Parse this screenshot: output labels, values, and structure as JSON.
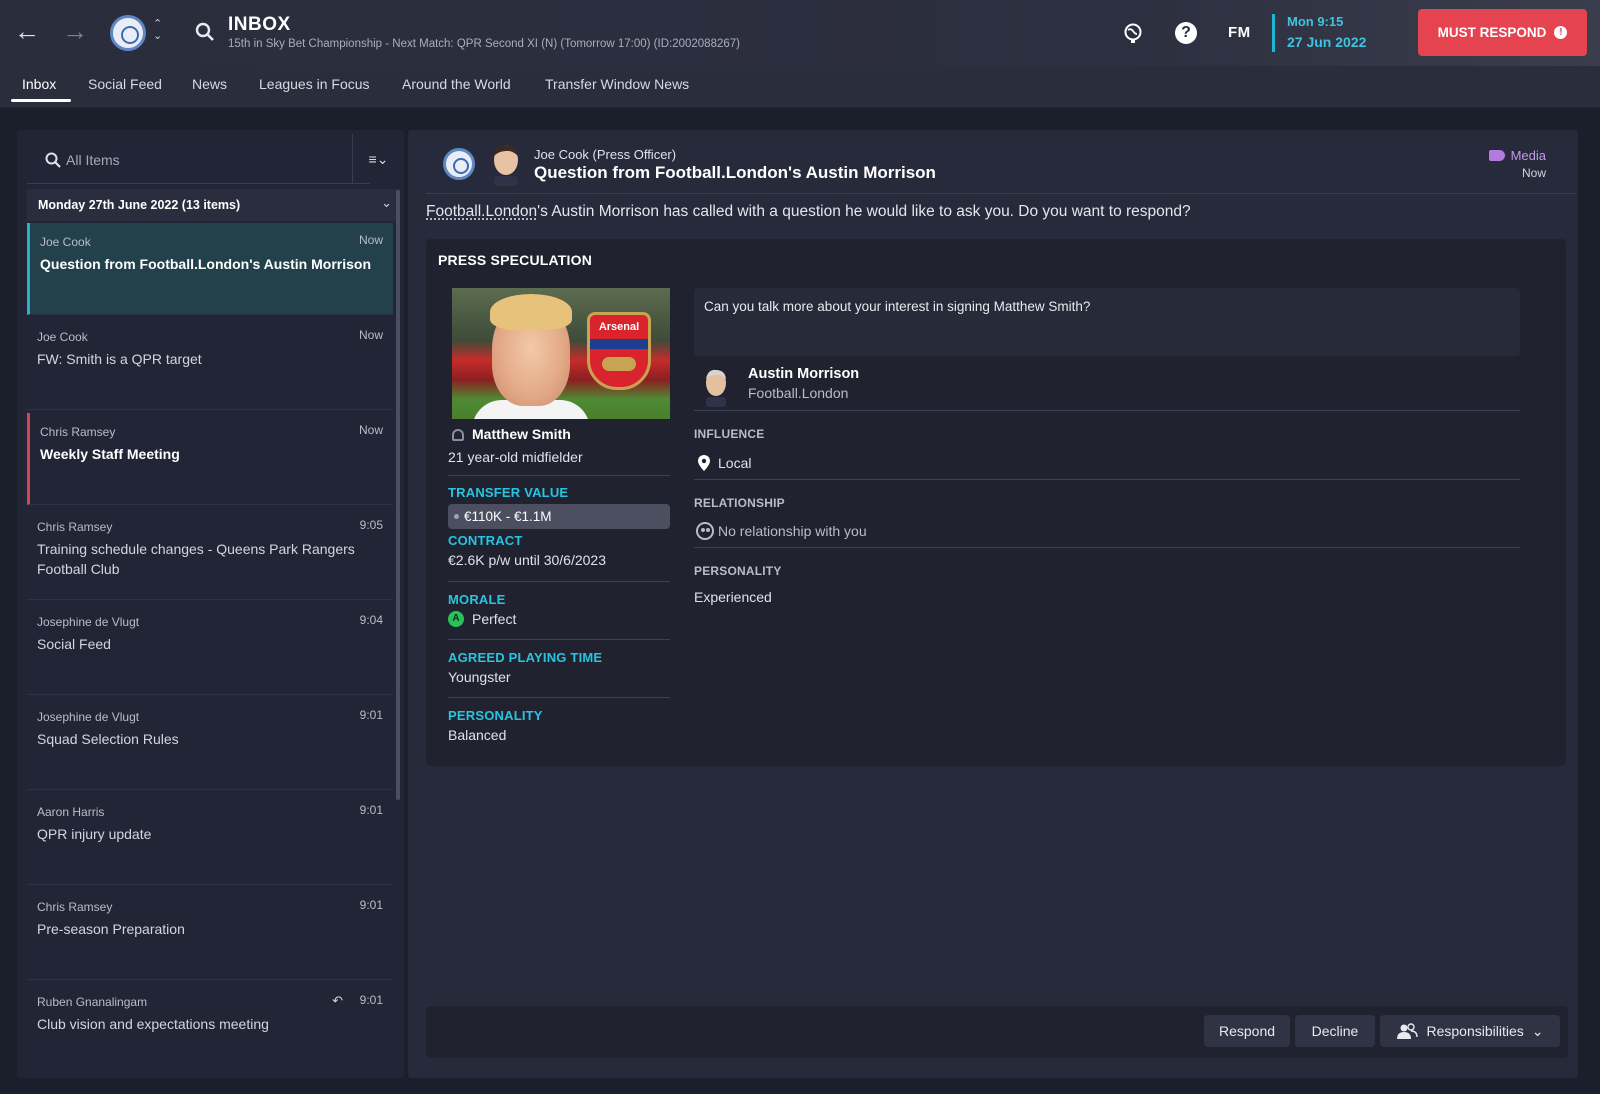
{
  "header": {
    "title": "INBOX",
    "subtitle": "15th in Sky Bet Championship - Next Match: QPR Second XI (N) (Tomorrow 17:00) (ID:2002088267)",
    "fm_logo": "FM",
    "time": "Mon 9:15",
    "date": "27 Jun 2022",
    "must_respond": "MUST RESPOND",
    "accent_color": "#1fb4d6",
    "alert_color": "#e5434f"
  },
  "tabs": [
    {
      "label": "Inbox",
      "active": true
    },
    {
      "label": "Social Feed"
    },
    {
      "label": "News"
    },
    {
      "label": "Leagues in Focus"
    },
    {
      "label": "Around the World"
    },
    {
      "label": "Transfer Window News"
    }
  ],
  "inbox": {
    "search_placeholder": "All Items",
    "group_label": "Monday 27th June 2022 (13 items)",
    "messages": [
      {
        "from": "Joe Cook",
        "time": "Now",
        "subject": "Question from Football.London's Austin Morrison",
        "bold": true,
        "selected": true
      },
      {
        "from": "Joe Cook",
        "time": "Now",
        "subject": "FW: Smith is a QPR target"
      },
      {
        "from": "Chris Ramsey",
        "time": "Now",
        "subject": "Weekly Staff Meeting",
        "bold": true
      },
      {
        "from": "Chris Ramsey",
        "time": "9:05",
        "subject": "Training schedule changes - Queens Park Rangers Football Club"
      },
      {
        "from": "Josephine de Vlugt",
        "time": "9:04",
        "subject": "Social Feed"
      },
      {
        "from": "Josephine de Vlugt",
        "time": "9:01",
        "subject": "Squad Selection Rules"
      },
      {
        "from": "Aaron Harris",
        "time": "9:01",
        "subject": "QPR injury update"
      },
      {
        "from": "Chris Ramsey",
        "time": "9:01",
        "subject": "Pre-season Preparation"
      },
      {
        "from": "Ruben Gnanalingam",
        "time": "9:01",
        "subject": "Club vision and expectations meeting",
        "replied": true
      }
    ]
  },
  "mail": {
    "sender": "Joe Cook  (Press Officer)",
    "title": "Question from Football.London's Austin Morrison",
    "category": "Media",
    "time": "Now",
    "intro_prefix": "Football.London",
    "intro_rest": "'s Austin Morrison has called with a question he would like to ask you. Do you want to respond?",
    "press_title": "PRESS SPECULATION",
    "player": {
      "photo_crest_text": "Arsenal",
      "name": "Matthew Smith",
      "description": "21 year-old midfielder",
      "transfer_value_label": "TRANSFER VALUE",
      "transfer_value": "€110K - €1.1M",
      "contract_label": "CONTRACT",
      "contract": "€2.6K p/w until 30/6/2023",
      "morale_label": "MORALE",
      "morale_grade": "A",
      "morale": "Perfect",
      "playing_time_label": "AGREED PLAYING TIME",
      "playing_time": "Youngster",
      "personality_label": "PERSONALITY",
      "personality": "Balanced"
    },
    "question": "Can you talk more about your interest in signing Matthew Smith?",
    "reporter": {
      "name": "Austin Morrison",
      "org": "Football.London",
      "influence_label": "INFLUENCE",
      "influence": "Local",
      "relationship_label": "RELATIONSHIP",
      "relationship": "No relationship with you",
      "personality_label": "PERSONALITY",
      "personality": "Experienced"
    },
    "actions": {
      "respond": "Respond",
      "decline": "Decline",
      "responsibilities": "Responsibilities"
    }
  }
}
